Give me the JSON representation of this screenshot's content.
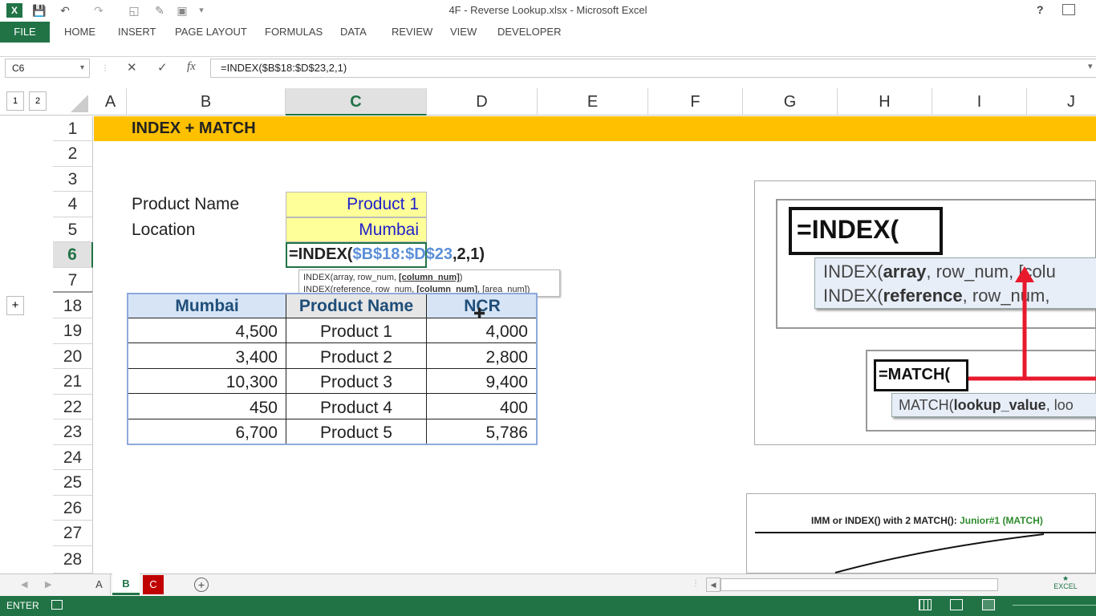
{
  "window": {
    "title": "4F - Reverse Lookup.xlsx - Microsoft Excel",
    "help": "?"
  },
  "ribbon": {
    "tabs": [
      "FILE",
      "HOME",
      "INSERT",
      "PAGE LAYOUT",
      "FORMULAS",
      "DATA",
      "REVIEW",
      "VIEW",
      "DEVELOPER"
    ]
  },
  "formula_bar": {
    "name_box": "C6",
    "formula": "=INDEX($B$18:$D$23,2,1)",
    "fx_label": "fx"
  },
  "grid": {
    "outline_levels": [
      "1",
      "2"
    ],
    "columns": [
      "A",
      "B",
      "C",
      "D",
      "E",
      "F",
      "G",
      "H",
      "I",
      "J"
    ],
    "rows": [
      "1",
      "2",
      "3",
      "4",
      "5",
      "6",
      "7",
      "18",
      "19",
      "20",
      "21",
      "22",
      "23",
      "24",
      "25",
      "26",
      "27",
      "28"
    ],
    "expand_button": "+"
  },
  "sheet": {
    "title": "INDEX + MATCH",
    "product_label": "Product Name",
    "product_value": "Product 1",
    "location_label": "Location",
    "location_value": "Mumbai",
    "editing_formula_prefix": "=INDEX(",
    "editing_formula_ref": "$B$18:$D$23",
    "editing_formula_suffix": ",2,1)",
    "tooltip_line1_a": "INDEX(array, row_num, ",
    "tooltip_line1_b": "[column_num]",
    "tooltip_line1_c": ")",
    "tooltip_line2_a": "INDEX(reference, row_num, ",
    "tooltip_line2_b": "[column_num]",
    "tooltip_line2_c": ", [area_num])"
  },
  "table": {
    "headers": [
      "Mumbai",
      "Product Name",
      "NCR"
    ],
    "rows": [
      [
        "4,500",
        "Product 1",
        "4,000"
      ],
      [
        "3,400",
        "Product 2",
        "2,800"
      ],
      [
        "10,300",
        "Product 3",
        "9,400"
      ],
      [
        "450",
        "Product 4",
        "400"
      ],
      [
        "6,700",
        "Product 5",
        "5,786"
      ]
    ]
  },
  "image1": {
    "index_text": "=INDEX(",
    "index_tip1_a": "INDEX(",
    "index_tip1_b": "array",
    "index_tip1_c": ", row_num, [colu",
    "index_tip2_a": "INDEX(",
    "index_tip2_b": "reference",
    "index_tip2_c": ", row_num,",
    "match_text": "=MATCH(",
    "match_tip_a": "MATCH(",
    "match_tip_b": "lookup_value",
    "match_tip_c": ", loo"
  },
  "image2": {
    "caption_a": "IMM or INDEX() with 2 MATCH(): ",
    "caption_b": "Junior#1 (MATCH)"
  },
  "sheet_tabs": {
    "tabs": [
      "A",
      "B",
      "C"
    ],
    "active": "B",
    "add": "+"
  },
  "status": {
    "mode": "ENTER",
    "logo": "EXCEL"
  },
  "colors": {
    "excel_green": "#217346",
    "title_band": "#ffc000",
    "input_yellow": "#ffff99",
    "table_header": "#d6e4f5",
    "link_blue": "#1f1fcc",
    "red_arrow": "#e8192c"
  }
}
